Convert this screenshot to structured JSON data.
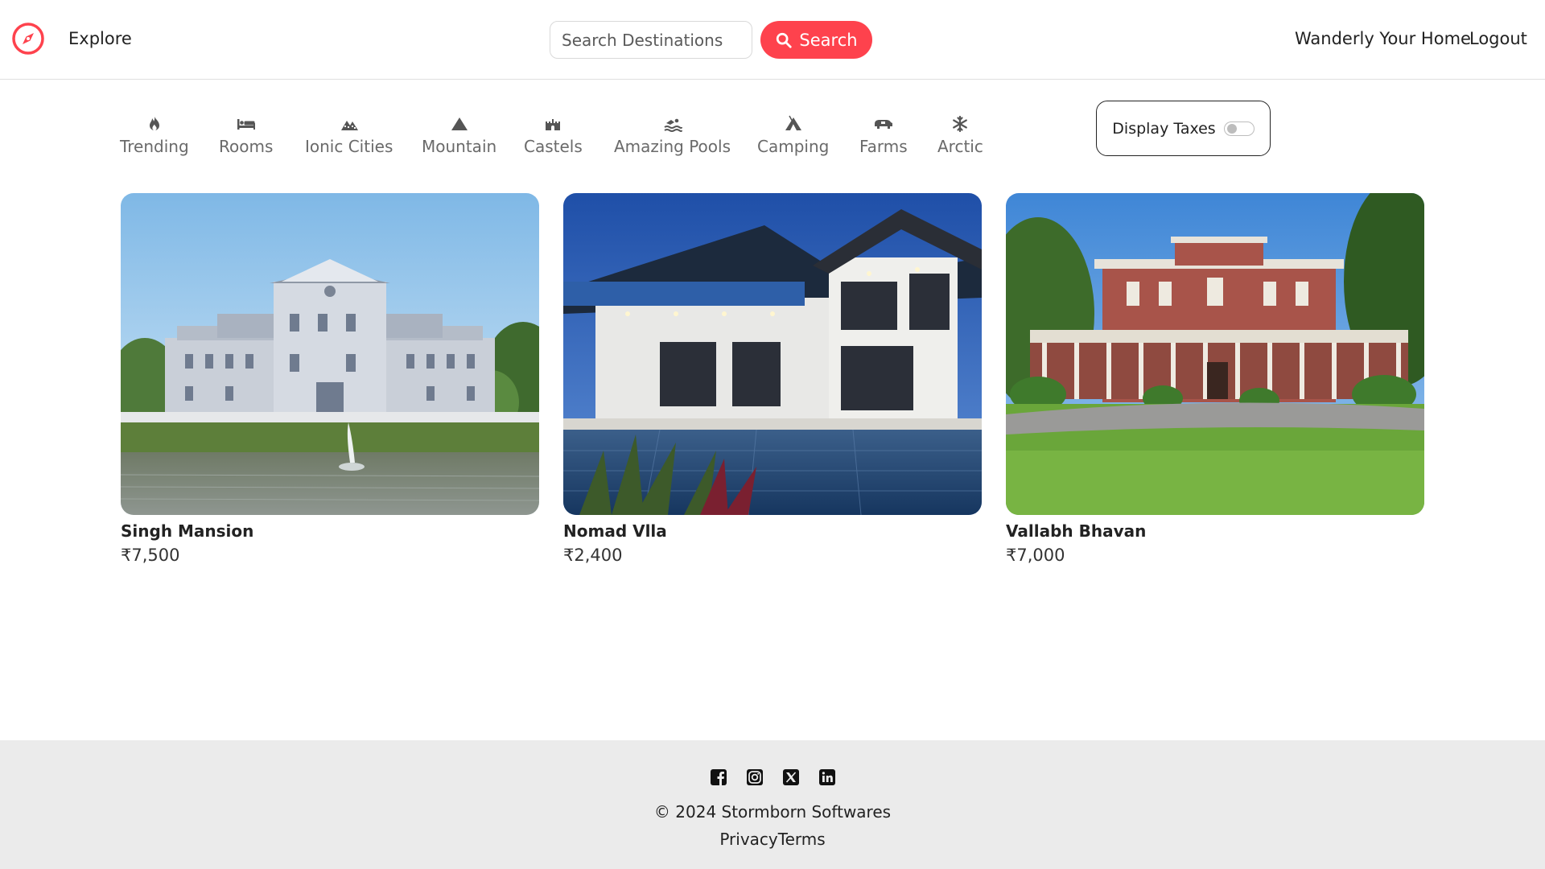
{
  "navbar": {
    "logo_icon": "compass-icon",
    "explore": "Explore",
    "search_placeholder": "Search Destinations",
    "search_button": "Search",
    "home_link": "Wanderly Your Home",
    "logout": "Logout",
    "brand_color": "#fe424d"
  },
  "filters": [
    {
      "label": "Trending",
      "icon": "fire-icon"
    },
    {
      "label": "Rooms",
      "icon": "bed-icon"
    },
    {
      "label": "Ionic Cities",
      "icon": "city-icon"
    },
    {
      "label": "Mountain",
      "icon": "mountain-icon"
    },
    {
      "label": "Castels",
      "icon": "castle-icon"
    },
    {
      "label": "Amazing Pools",
      "icon": "swimmer-icon"
    },
    {
      "label": "Camping",
      "icon": "campground-icon"
    },
    {
      "label": "Farms",
      "icon": "tractor-icon"
    },
    {
      "label": "Arctic",
      "icon": "snowflake-icon"
    }
  ],
  "tax_toggle": {
    "label": "Display Taxes",
    "checked": false
  },
  "listings": [
    {
      "title": "Singh Mansion",
      "price": "₹7,500"
    },
    {
      "title": "Nomad Vlla",
      "price": "₹2,400"
    },
    {
      "title": "Vallabh Bhavan",
      "price": "₹7,000"
    }
  ],
  "footer": {
    "social_icons": [
      "facebook-icon",
      "instagram-icon",
      "x-twitter-icon",
      "linkedin-icon"
    ],
    "copyright": "© 2024 Stormborn Softwares",
    "privacy": "Privacy",
    "terms": "Terms"
  }
}
